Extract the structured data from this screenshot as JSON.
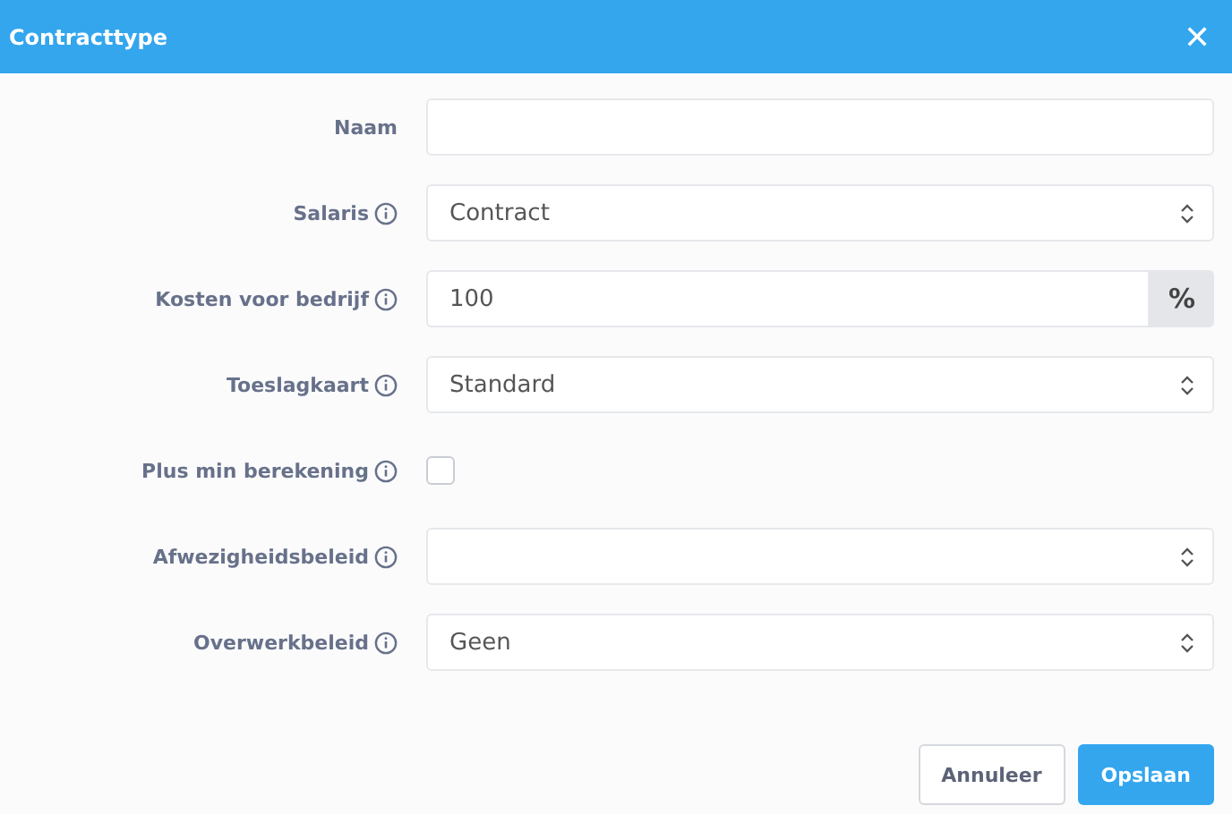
{
  "window": {
    "title": "Contracttype",
    "close": "✕"
  },
  "fields": [
    {
      "label": "Naam",
      "info": false,
      "kind": "text"
    },
    {
      "label": "Salaris",
      "info": true,
      "kind": "select",
      "value": "Contract"
    },
    {
      "label": "Kosten voor bedrijf",
      "info": true,
      "kind": "addon",
      "value": "100",
      "addon": "%"
    },
    {
      "label": "Toeslagkaart",
      "info": true,
      "kind": "select",
      "value": "Standard"
    },
    {
      "label": "Plus min berekening",
      "info": true,
      "kind": "checkbox",
      "checked": false
    },
    {
      "label": "Afwezigheidsbeleid",
      "info": true,
      "kind": "select"
    },
    {
      "label": "Overwerkbeleid",
      "info": true,
      "kind": "select",
      "value": "Geen"
    }
  ],
  "buttons": [
    {
      "label": "Annuleer",
      "kind": "secondary"
    },
    {
      "label": "Opslaan",
      "kind": "primary"
    }
  ]
}
